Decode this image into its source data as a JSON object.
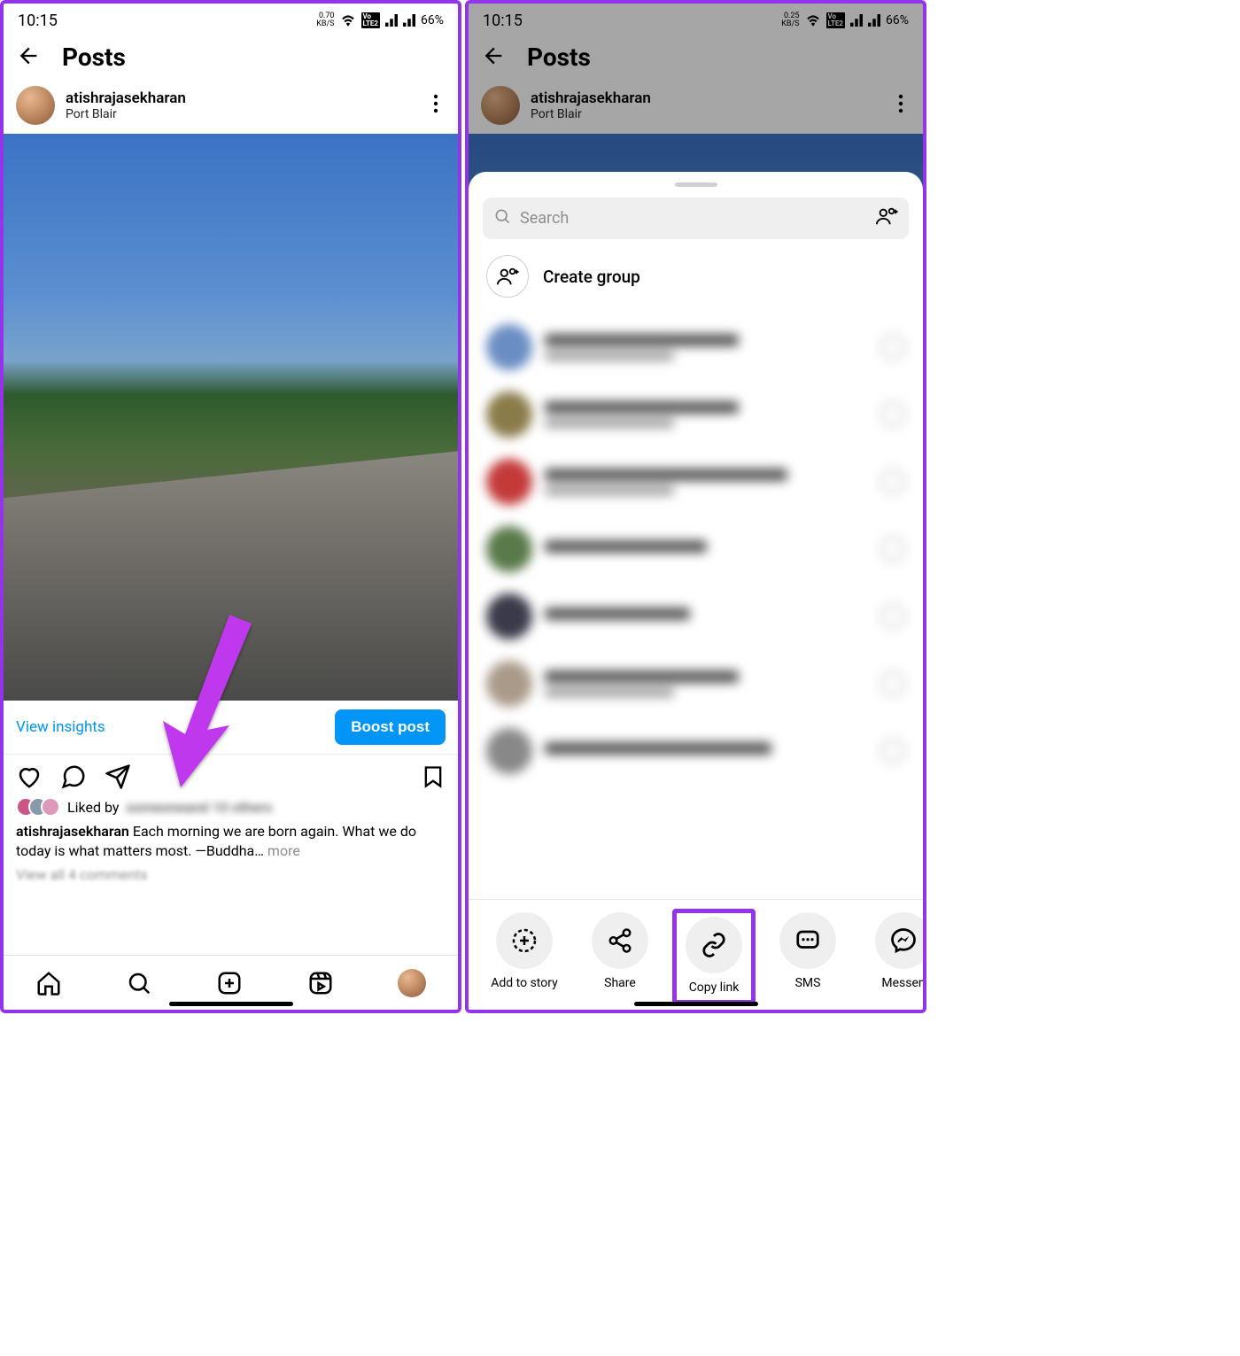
{
  "status": {
    "time": "10:15",
    "kbs_left": "0.70",
    "kbs_right": "0.25",
    "kbs_unit": "KB/S",
    "lte": "LTE 2",
    "battery": "66%"
  },
  "header": {
    "title": "Posts"
  },
  "post": {
    "username": "atishrajasekharan",
    "location": "Port Blair",
    "view_insights": "View insights",
    "boost_label": "Boost post",
    "liked_by_prefix": "Liked by",
    "caption_user": "atishrajasekharan",
    "caption_text": "Each morning we are born again. What we do today is what matters most. —Buddha",
    "more_label": "more",
    "view_comments": "View all 4 comments"
  },
  "sheet": {
    "search_placeholder": "Search",
    "create_group": "Create group"
  },
  "share_actions": {
    "add_to_story": "Add to story",
    "share": "Share",
    "copy_link": "Copy link",
    "sms": "SMS",
    "messenger": "Messen"
  }
}
